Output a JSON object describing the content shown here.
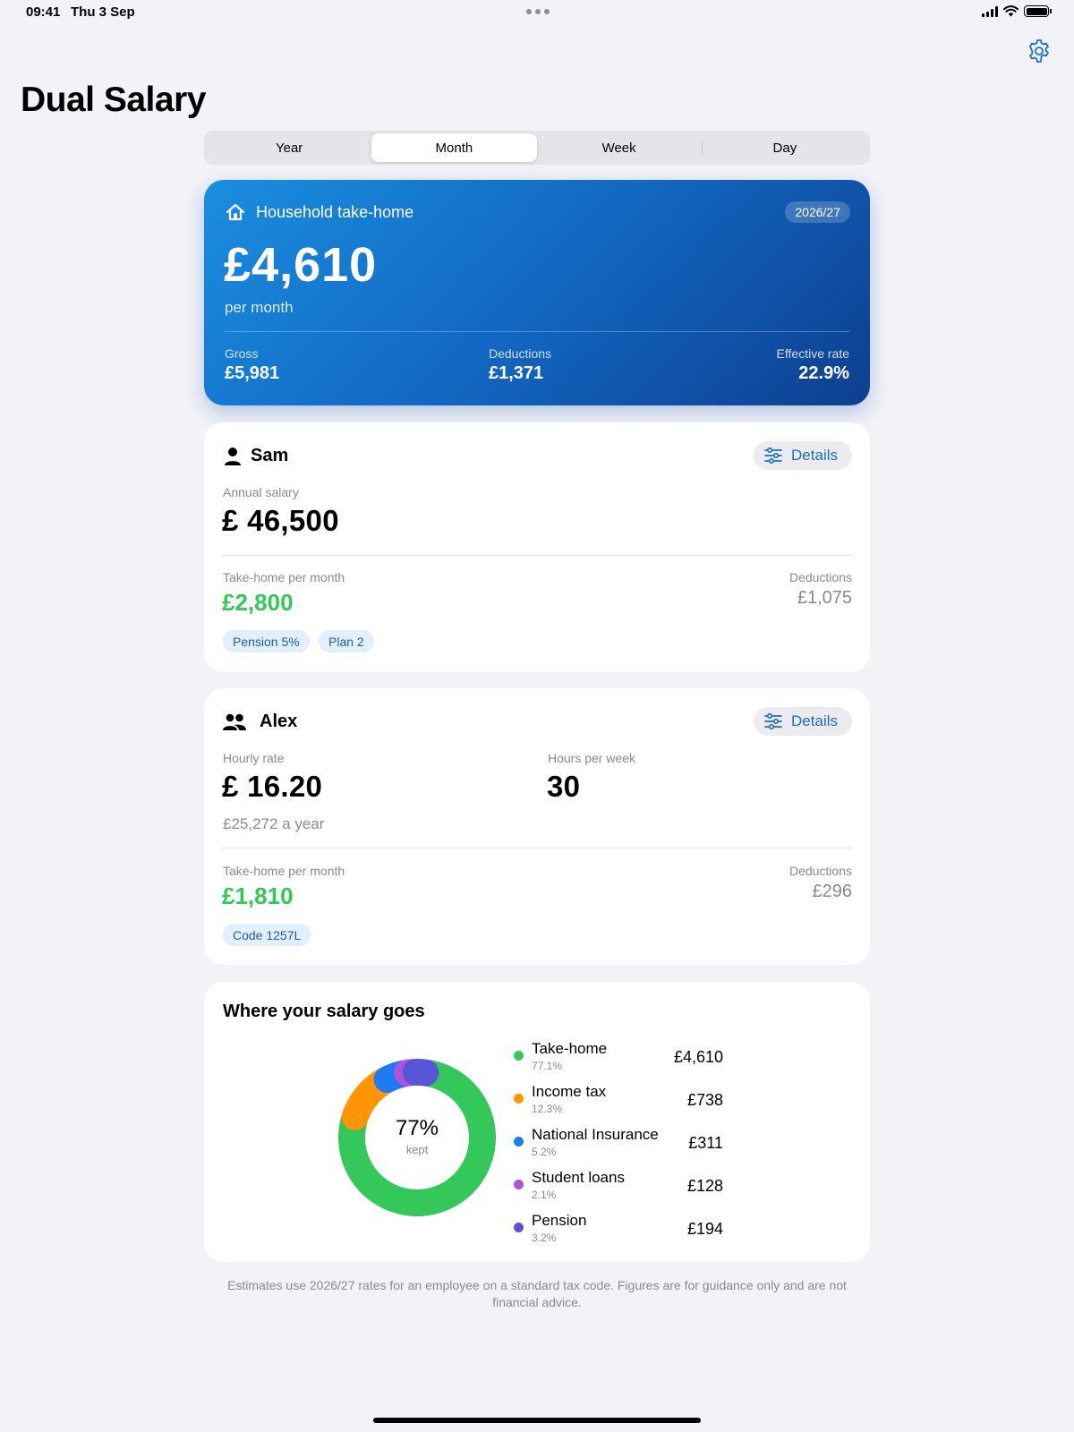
{
  "status_bar": {
    "time": "09:41",
    "date": "Thu 3 Sep"
  },
  "title": "Dual Salary",
  "tabs": [
    {
      "label": "Year",
      "active": false
    },
    {
      "label": "Month",
      "active": true
    },
    {
      "label": "Week",
      "active": false
    },
    {
      "label": "Day",
      "active": false
    }
  ],
  "household": {
    "title": "Household take-home",
    "badge": "2026/27",
    "amount": "£4,610",
    "period": "per month",
    "stats": [
      {
        "label": "Gross",
        "value": "£5,981"
      },
      {
        "label": "Deductions",
        "value": "£1,371"
      },
      {
        "label": "Effective rate",
        "value": "22.9%"
      }
    ]
  },
  "sam": {
    "name": "Sam",
    "details_label": "Details",
    "salary_label": "Annual salary",
    "salary_value": "£ 46,500",
    "takehome_label": "Take-home per month",
    "takehome_value": "£2,800",
    "deductions_label": "Deductions",
    "deductions_value": "£1,075",
    "chips": [
      "Pension 5%",
      "Plan 2"
    ]
  },
  "alex": {
    "name": "Alex",
    "details_label": "Details",
    "rate_label": "Hourly rate",
    "rate_value": "£ 16.20",
    "yearly": "£25,272 a year",
    "hours_label": "Hours per week",
    "hours_value": "30",
    "takehome_label": "Take-home per month",
    "takehome_value": "£1,810",
    "deductions_label": "Deductions",
    "deductions_value": "£296",
    "chips": [
      "Code 1257L"
    ]
  },
  "breakdown": {
    "title": "Where your salary goes",
    "center_value": "77%",
    "center_label": "kept",
    "items": [
      {
        "name": "Take-home",
        "pct": "77.1%",
        "amount": "£4,610",
        "color": "#34c759"
      },
      {
        "name": "Income tax",
        "pct": "12.3%",
        "amount": "£738",
        "color": "#ff9500"
      },
      {
        "name": "National Insurance",
        "pct": "5.2%",
        "amount": "£311",
        "color": "#1e7cf0"
      },
      {
        "name": "Student loans",
        "pct": "2.1%",
        "amount": "£128",
        "color": "#af52de"
      },
      {
        "name": "Pension",
        "pct": "3.2%",
        "amount": "£194",
        "color": "#5856d6"
      }
    ]
  },
  "chart_data": {
    "type": "pie",
    "categories": [
      "Take-home",
      "Income tax",
      "National Insurance",
      "Student loans",
      "Pension"
    ],
    "values": [
      77.1,
      12.3,
      5.2,
      2.1,
      3.2
    ],
    "title": "Where your salary goes"
  },
  "footnote": "Estimates use 2026/27 rates for an employee on a standard tax code. Figures are for guidance only and are not financial advice."
}
